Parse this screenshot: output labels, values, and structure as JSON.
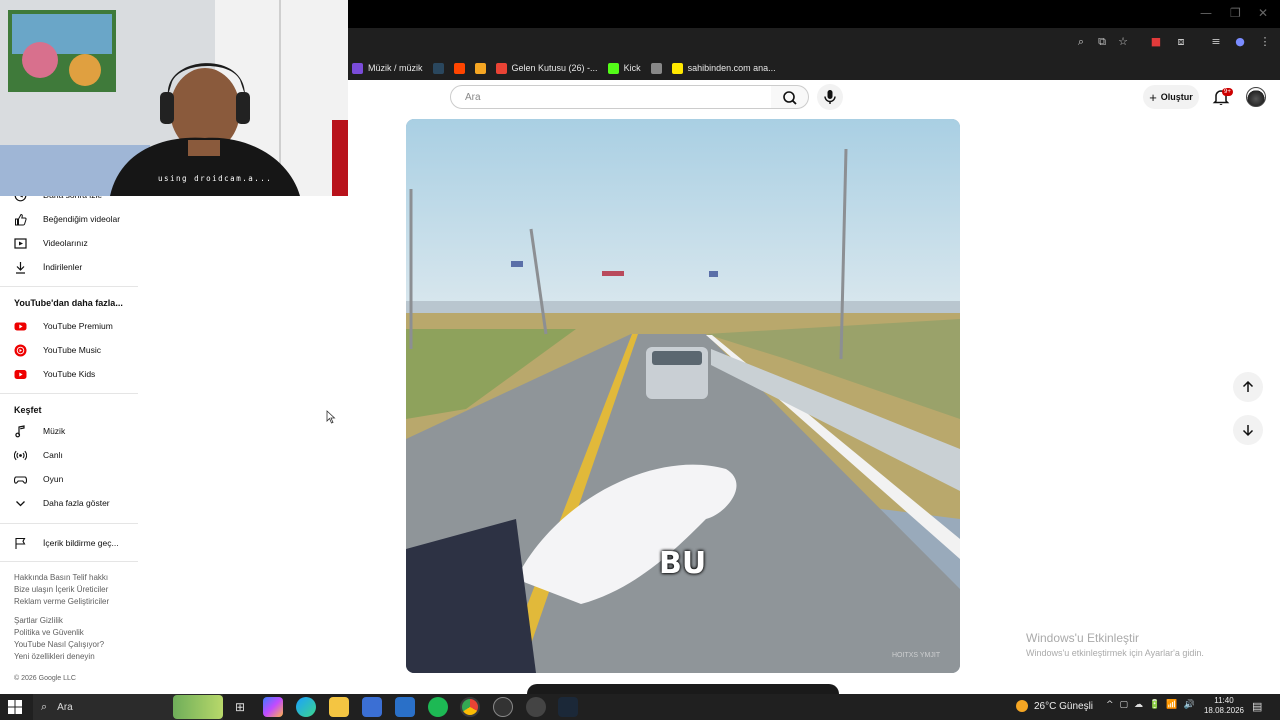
{
  "bookmarks": [
    {
      "label": "Müzik / müzik",
      "color": "#7a4cd9"
    },
    {
      "label": "",
      "color": "#2a475e"
    },
    {
      "label": "",
      "color": "#ff4500"
    },
    {
      "label": "",
      "color": "#f5a623"
    },
    {
      "label": "Gelen Kutusu (26) -...",
      "color": "#ea4335"
    },
    {
      "label": "Kick",
      "color": "#53fc18"
    },
    {
      "label": "",
      "color": "#888888"
    },
    {
      "label": "sahibinden.com ana...",
      "color": "#ffe800"
    }
  ],
  "webcam": {
    "overlay_text": "using droidcam.a..."
  },
  "header": {
    "search_placeholder": "Ara",
    "create_label": "Oluştur",
    "notification_count": "9+"
  },
  "sidebar": {
    "you_items": [
      {
        "label": "Daha sonra izle",
        "icon": "watch-later-icon"
      },
      {
        "label": "Beğendiğim videolar",
        "icon": "thumbs-up-icon"
      },
      {
        "label": "Videolarınız",
        "icon": "play-box-icon"
      },
      {
        "label": "İndirilenler",
        "icon": "download-icon"
      }
    ],
    "more_heading": "YouTube'dan daha fazla...",
    "more_items": [
      {
        "label": "YouTube Premium",
        "icon": "youtube-premium-icon"
      },
      {
        "label": "YouTube Music",
        "icon": "youtube-music-icon"
      },
      {
        "label": "YouTube Kids",
        "icon": "youtube-kids-icon"
      }
    ],
    "explore_heading": "Keşfet",
    "explore_items": [
      {
        "label": "Müzik",
        "icon": "music-note-icon"
      },
      {
        "label": "Canlı",
        "icon": "live-icon"
      },
      {
        "label": "Oyun",
        "icon": "gamepad-icon"
      },
      {
        "label": "Daha fazla göster",
        "icon": "chevron-down-icon"
      }
    ],
    "report_item": {
      "label": "İçerik bildirme geç...",
      "icon": "flag-icon"
    },
    "footer_lines_1": [
      "Hakkında  Basın  Telif hakkı",
      "Bize ulaşın  İçerik Üreticiler",
      "Reklam verme  Geliştiriciler"
    ],
    "footer_lines_2": [
      "Şartlar  Gizlilik",
      "Politika ve Güvenlik",
      "YouTube Nasıl Çalışıyor?",
      "Yeni özellikleri deneyin"
    ],
    "copyright": "© 2026 Google LLC"
  },
  "video": {
    "caption": "BU",
    "watermark": "HOITXS YMJIT"
  },
  "windows_activation": {
    "title": "Windows'u Etkinleştir",
    "subtitle": "Windows'u etkinleştirmek için Ayarlar'a gidin."
  },
  "taskbar": {
    "search_label": "Ara",
    "weather": "26°C  Güneşli",
    "time": "11:40",
    "date": "18.08.2026"
  }
}
